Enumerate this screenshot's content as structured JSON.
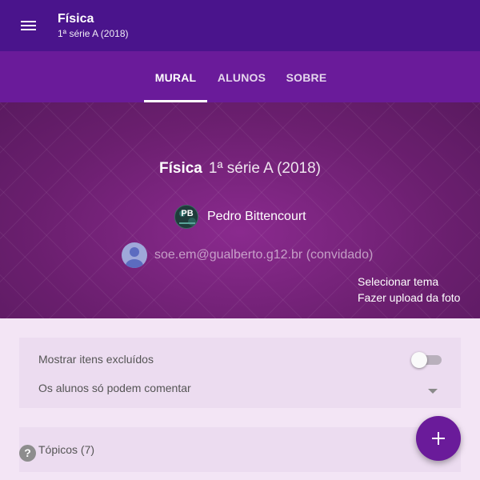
{
  "header": {
    "title": "Física",
    "subtitle": "1ª série A (2018)",
    "menu_icon": "menu-icon",
    "bg_color": "#4a148c"
  },
  "tabs": [
    {
      "label": "MURAL",
      "active": true
    },
    {
      "label": "ALUNOS",
      "active": false
    },
    {
      "label": "SOBRE",
      "active": false
    }
  ],
  "banner": {
    "course_name": "Física",
    "section": "1ª série A (2018)",
    "teacher": {
      "initials": "PB",
      "name": "Pedro Bittencourt"
    },
    "guest": {
      "email": "soe.em@gualberto.g12.br (convidado)",
      "avatar_icon": "person-icon"
    },
    "select_theme": "Selecionar tema",
    "upload_photo": "Fazer upload da foto",
    "bg_color": "#6b1f6f"
  },
  "settings": {
    "show_deleted_label": "Mostrar itens excluídos",
    "show_deleted_on": false,
    "comment_permission_label": "Os alunos só podem comentar"
  },
  "topics": {
    "label": "Tópicos (7)"
  },
  "help": {
    "glyph": "?"
  },
  "fab": {
    "icon": "plus-icon",
    "color": "#6a1b9a"
  }
}
